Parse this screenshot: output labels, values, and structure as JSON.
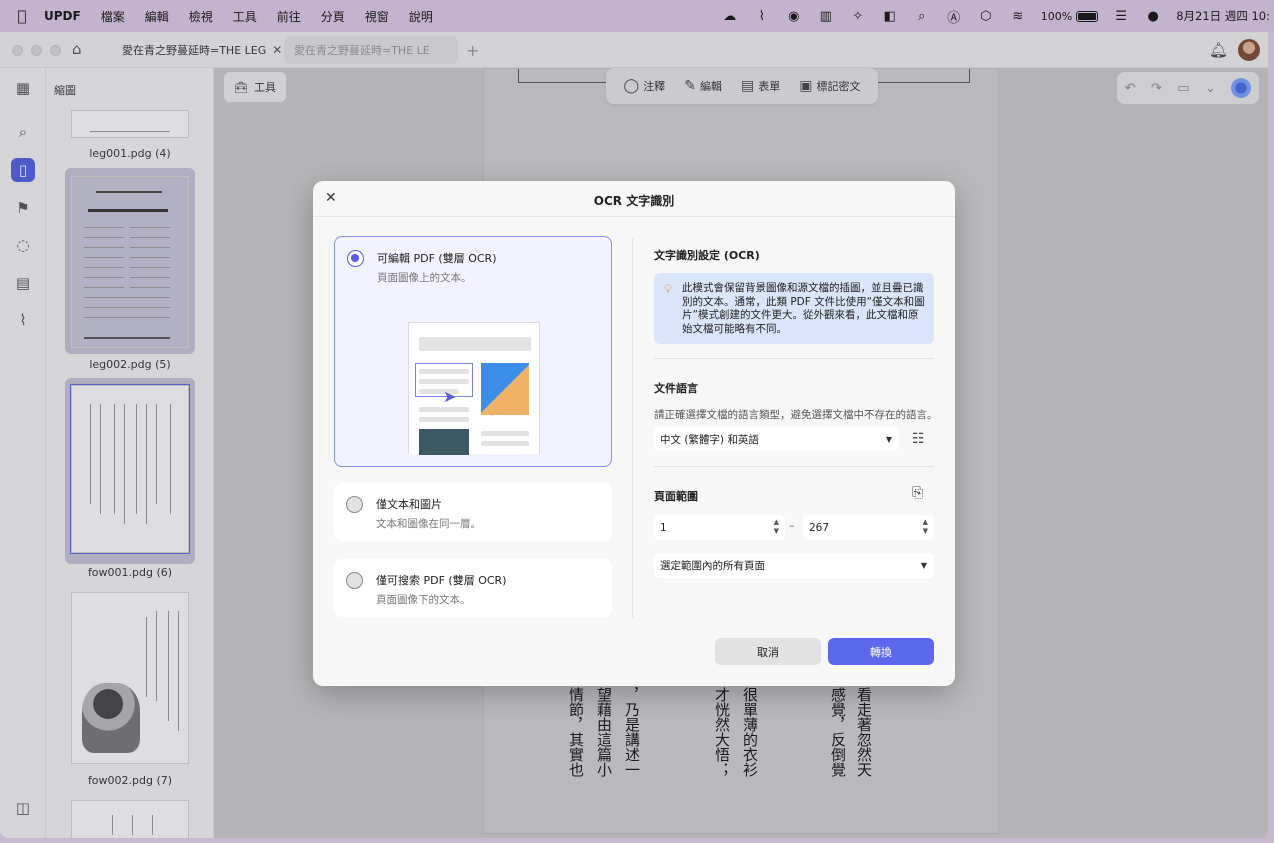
{
  "menubar": {
    "app": "UPDF",
    "items": [
      "檔案",
      "編輯",
      "檢視",
      "工具",
      "前往",
      "分頁",
      "視窗",
      "說明"
    ],
    "battery": "100%",
    "clock": "8月21日 週四 10:"
  },
  "window": {
    "tabs": [
      {
        "label": "愛在青之野蔓延時=THE LEG",
        "active": true
      },
      {
        "label": "愛在青之野蔓延時=THE LE",
        "active": false
      }
    ]
  },
  "sidebar": {
    "panel_title": "縮圖",
    "thumbnails": [
      {
        "label": "leg001.pdg (4)"
      },
      {
        "label": "leg002.pdg (5)"
      },
      {
        "label": "fow001.pdg (6)"
      },
      {
        "label": "fow002.pdg (7)"
      }
    ]
  },
  "toolbar": {
    "tools_label": "工具",
    "doc_tools": [
      "注釋",
      "編輯",
      "表單",
      "標記密文"
    ]
  },
  "document": {
    "columns": [
      "情節，其實也",
      "望藉由這篇小",
      "，乃是講述一",
      "才恍然大悟；",
      "很單薄的衣衫",
      "感覺，反倒覺",
      "看走著忽然天"
    ]
  },
  "dialog": {
    "title": "OCR 文字識別",
    "options": [
      {
        "title": "可編輯 PDF (雙層 OCR)",
        "subtitle": "頁面圖像上的文本。",
        "selected": true
      },
      {
        "title": "僅文本和圖片",
        "subtitle": "文本和圖像在同一層。",
        "selected": false
      },
      {
        "title": "僅可搜索 PDF (雙層 OCR)",
        "subtitle": "頁面圖像下的文本。",
        "selected": false
      }
    ],
    "settings_title": "文字識別設定 (OCR)",
    "info_text": "此模式會保留背景圖像和源文檔的插圖，並且疊已識別的文本。通常，此類 PDF 文件比使用“僅文本和圖片”模式創建的文件更大。從外觀來看，此文檔和原始文檔可能略有不同。",
    "language_title": "文件語言",
    "language_hint": "請正確選擇文檔的語言類型，避免選擇文檔中不存在的語言。",
    "language_value": "中文 (繁體字) 和英語",
    "page_range_title": "頁面範圍",
    "page_from": "1",
    "page_to": "267",
    "page_scope": "選定範圍內的所有頁面",
    "cancel_label": "取消",
    "convert_label": "轉換"
  },
  "colors": {
    "accent": "#5b68ee",
    "menubar": "#c4b3cf",
    "info_bg": "#d9e5fb"
  }
}
